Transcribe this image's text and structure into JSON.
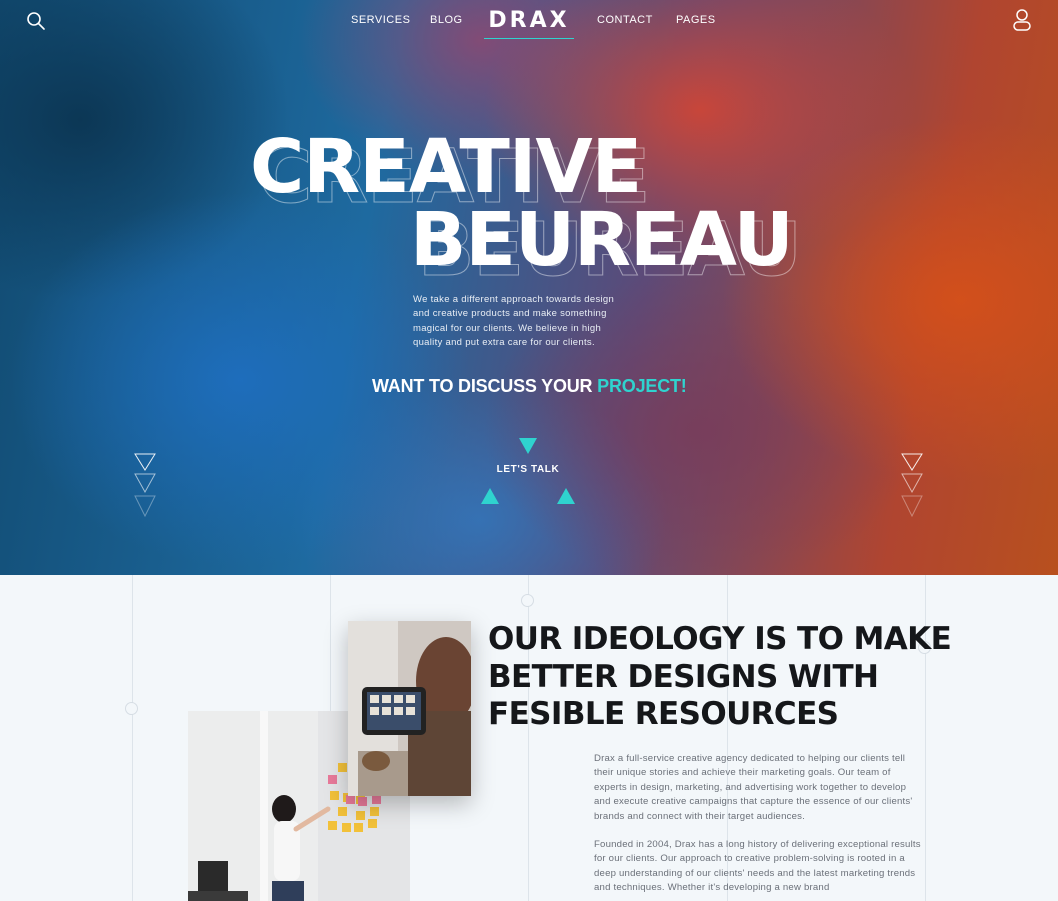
{
  "nav": {
    "links_left": [
      "SERVICES",
      "BLOG"
    ],
    "links_right": [
      "CONTACT",
      "PAGES"
    ],
    "logo_text": "DRAX",
    "search_icon": "search-icon",
    "user_icon": "user-icon"
  },
  "hero": {
    "title_line1": "CREATIVE",
    "title_line2": "BEUREAU",
    "description": "We take a different approach towards design and creative products and make something magical for our clients. We believe in high quality and put extra care for our clients.",
    "cta_prefix": "WANT TO DISCUSS YOUR ",
    "cta_accent": "PROJECT!",
    "talk_label": "LET'S TALK"
  },
  "about": {
    "title_lines": [
      "OUR IDEOLOGY IS TO MAKE",
      "BETTER DESIGNS  WITH",
      "FESIBLE RESOURCES"
    ],
    "paragraph_1": "Drax a full-service creative agency dedicated to helping our clients tell their unique stories and achieve their marketing goals. Our team of experts in design, marketing, and advertising work together to develop and execute creative campaigns that capture the essence of our clients' brands and connect with their target audiences.",
    "paragraph_2": "Founded in 2004, Drax has a long history of delivering exceptional results for our clients. Our approach to creative problem-solving is rooted in a deep understanding of our clients' needs and the latest marketing trends and techniques. Whether it's developing a new brand"
  },
  "colors": {
    "accent": "#2fd3cf",
    "heading_dark": "#15171a",
    "body_text": "#6b7079",
    "section_bg": "#f3f7fa"
  }
}
